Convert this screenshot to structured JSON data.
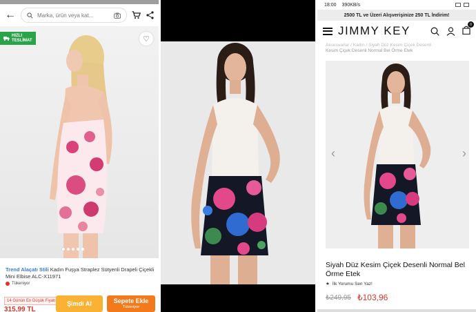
{
  "panel1": {
    "search_placeholder": "Marka, ürün veya kat...",
    "badge_line1": "HIZLI",
    "badge_line2": "TESLİMAT",
    "brand": "Trend Alaçatı Stili",
    "product_title": " Kadın Fuşya Straplez Sütyenli Drapeli Çiçekli Mini Elbise ALC-X11971",
    "stock_status": "Tükeniyor",
    "lowest_price_badge": "14 Günün En Düşük Fiyatı",
    "price": "315,99 TL",
    "buy_now_label": "Şimdi Al",
    "add_to_cart_label": "Sepete Ekle",
    "add_to_cart_sub": "Tükeniyor",
    "icons": [
      "back-arrow-icon",
      "search-icon",
      "camera-icon",
      "cart-icon",
      "share-icon",
      "heart-icon"
    ]
  },
  "panel3": {
    "status_time": "18:00",
    "status_speed": "390KB/s",
    "promo_text": "2500 TL ve Üzeri Alışverişinize 250 TL İndirim!",
    "logo": "JIMMY KEY",
    "cart_count": "0",
    "breadcrumb_line1": "Aksesuarlar / Kadın / Siyah Düz Kesim Çiçek Desenli",
    "breadcrumb_line2": "Kesim Çiçek Desenli Normal Bel Örme Etek",
    "product_name": "Siyah Düz Kesim Çiçek Desenli Normal Bel Örme Etek",
    "review_text": "İlk Yorumu Sen Yaz!",
    "old_price": "₺249,95",
    "new_price": "₺103,96",
    "icons": [
      "menu-icon",
      "search-icon",
      "user-icon",
      "bag-icon",
      "chevron-left-icon",
      "chevron-right-icon",
      "star-icon"
    ]
  },
  "colors": {
    "trendyol_orange": "#f27a1a",
    "buy_yellow": "#f9b233",
    "price_red": "#d9342b",
    "badge_green": "#2aa34a",
    "brand_blue": "#3a7bd5"
  }
}
